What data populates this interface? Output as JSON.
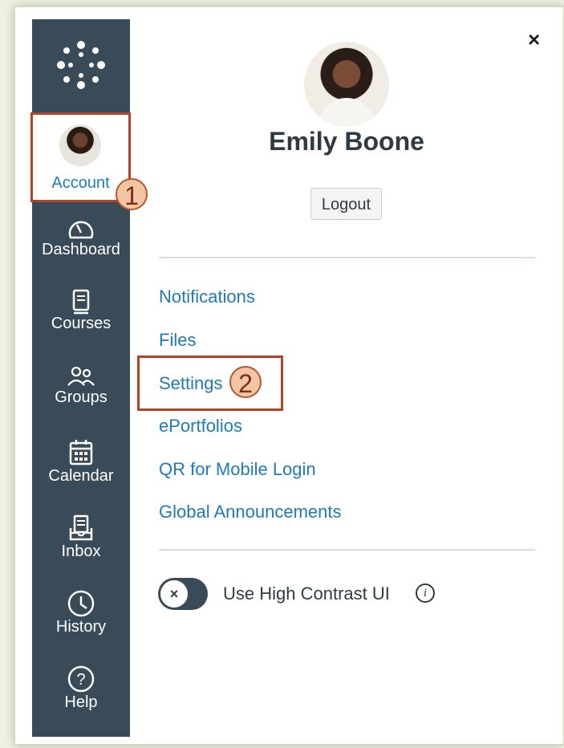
{
  "nav": {
    "account": {
      "label": "Account"
    },
    "items": [
      {
        "label": "Dashboard",
        "icon": "dashboard-icon"
      },
      {
        "label": "Courses",
        "icon": "courses-icon"
      },
      {
        "label": "Groups",
        "icon": "groups-icon"
      },
      {
        "label": "Calendar",
        "icon": "calendar-icon"
      },
      {
        "label": "Inbox",
        "icon": "inbox-icon"
      },
      {
        "label": "History",
        "icon": "history-icon"
      },
      {
        "label": "Help",
        "icon": "help-icon"
      }
    ]
  },
  "callouts": {
    "one": "1",
    "two": "2"
  },
  "tray": {
    "close_label": "×",
    "user_name": "Emily Boone",
    "logout_label": "Logout",
    "links": [
      {
        "label": "Notifications"
      },
      {
        "label": "Files"
      },
      {
        "label": "Settings"
      },
      {
        "label": "ePortfolios"
      },
      {
        "label": "QR for Mobile Login"
      },
      {
        "label": "Global Announcements"
      }
    ],
    "toggle": {
      "label": "Use High Contrast UI",
      "knob": "×",
      "info": "i",
      "checked": false
    }
  },
  "colors": {
    "nav_bg": "#394b58",
    "link": "#1f7ab8",
    "highlight": "#b54226"
  }
}
